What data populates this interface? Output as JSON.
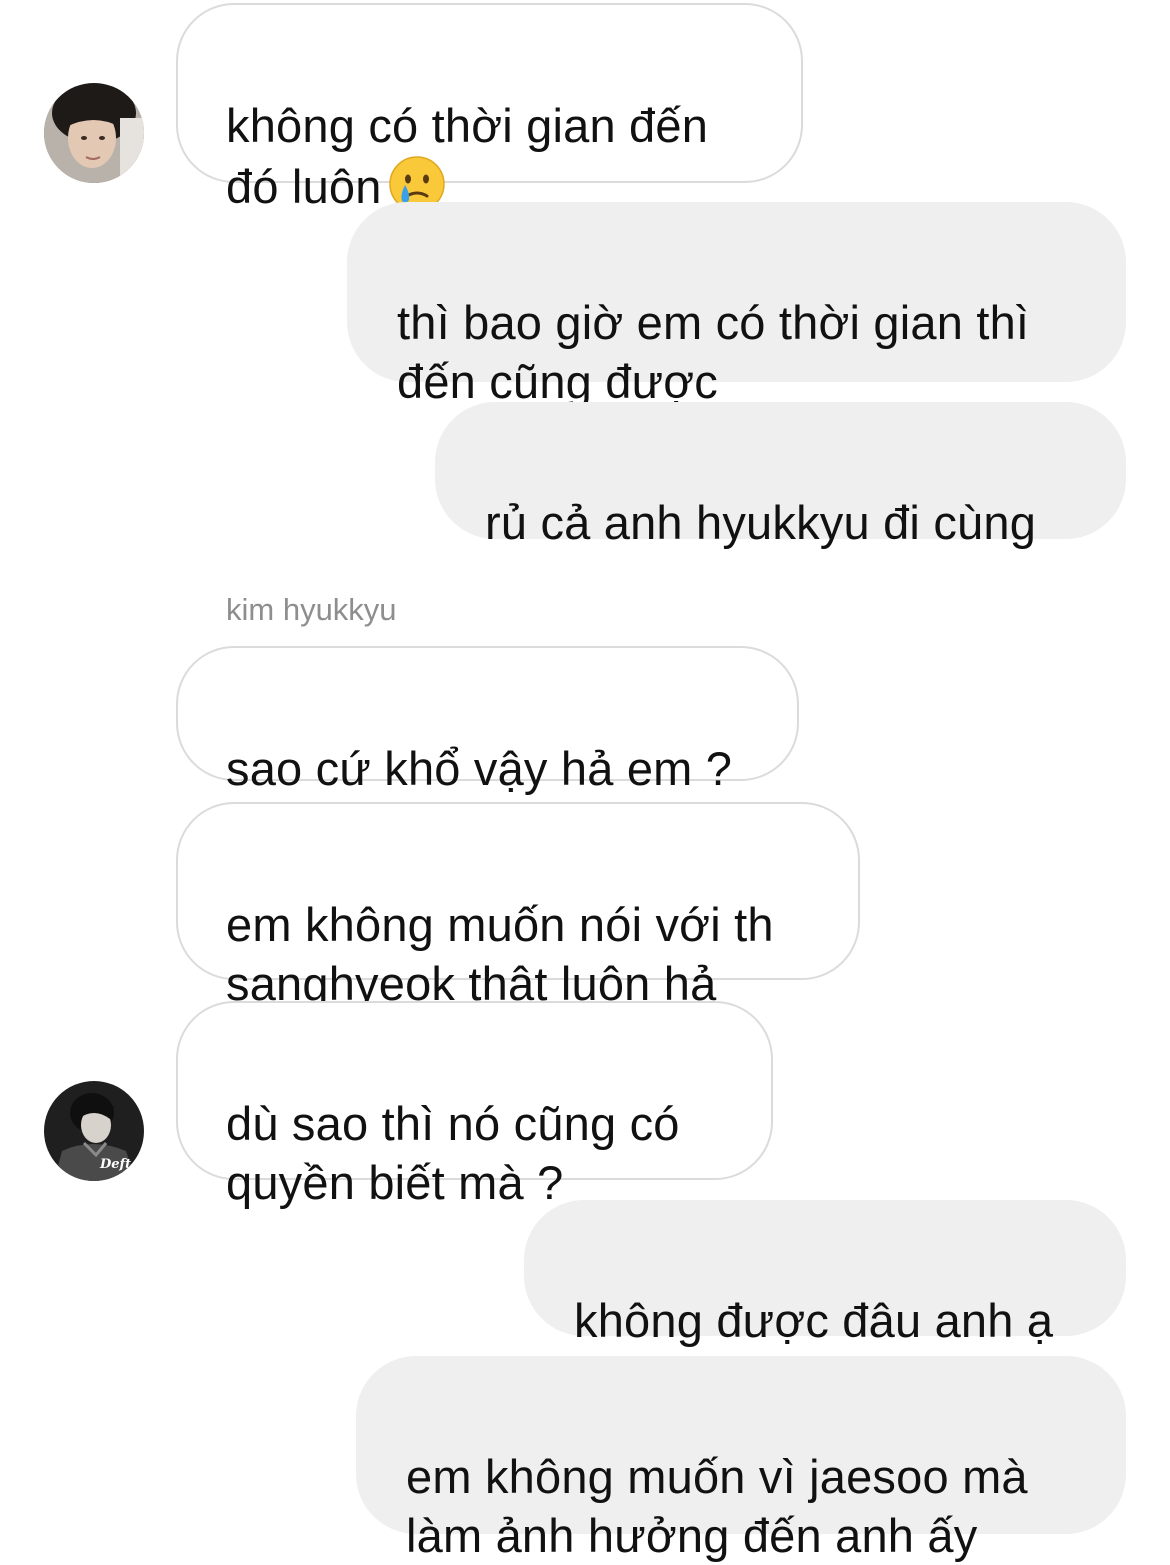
{
  "conversation": {
    "messages": [
      {
        "side": "incoming",
        "text": "không có thời gian đến\nđó luôn",
        "emoji": "crying-face-emoji"
      },
      {
        "side": "outgoing",
        "text": "thì bao giờ em có thời gian thì\nđến cũng được"
      },
      {
        "side": "outgoing",
        "text": "rủ cả anh hyukkyu đi cùng"
      },
      {
        "side": "incoming",
        "text": "sao cứ khổ vậy hả em ?"
      },
      {
        "side": "incoming",
        "text": "em không muốn nói với th\nsanghyeok thật luôn hả"
      },
      {
        "side": "incoming",
        "text": "dù sao thì nó cũng có\nquyền biết mà ?"
      },
      {
        "side": "outgoing",
        "text": "không được đâu anh ạ"
      },
      {
        "side": "outgoing",
        "text": "em không muốn vì jaesoo mà\nlàm ảnh hưởng đến anh ấy"
      }
    ],
    "sender_label": "kim hyukkyu",
    "avatar_badge": "Deft"
  },
  "colors": {
    "incoming_bg": "#ffffff",
    "incoming_border": "#dbdbdb",
    "outgoing_bg": "#efefef",
    "text": "#111111",
    "sender_label": "#8e8e8e"
  }
}
